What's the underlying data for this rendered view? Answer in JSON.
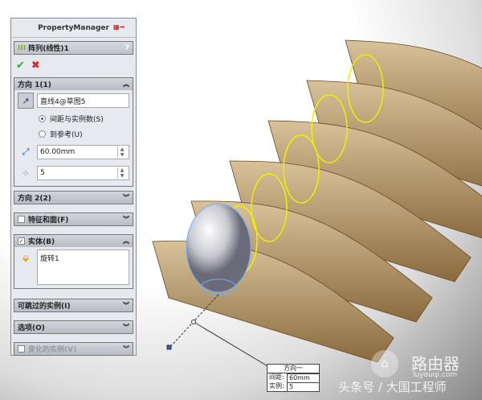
{
  "property_manager": {
    "title": "PropertyManager",
    "feature_title": "阵列(线性)1",
    "help": "?",
    "ok": "✔",
    "cancel": "✖",
    "direction1": {
      "label": "方向 1(1)",
      "edge": "直线4@草图5",
      "option_spacing": "间距与实例数(S)",
      "option_reference": "到参考(U)",
      "spacing": "60.00mm",
      "instances": "5"
    },
    "direction2": {
      "label": "方向 2(2)"
    },
    "features_faces": {
      "label": "特征和面(F)"
    },
    "bodies": {
      "label": "实体(B)",
      "item": "旋转1"
    },
    "skip": {
      "label": "可跳过的实例(I)"
    },
    "options": {
      "label": "选项(O)"
    },
    "varied": {
      "label": "变化的实例(V)"
    }
  },
  "callout": {
    "title": "方向一",
    "spacing_label": "间距:",
    "spacing": "60mm",
    "instances_label": "实例:",
    "instances": "5"
  },
  "watermark": {
    "brand": "路由器",
    "url": "luyouqi.com",
    "credit": "头条号 / 大国工程师"
  }
}
